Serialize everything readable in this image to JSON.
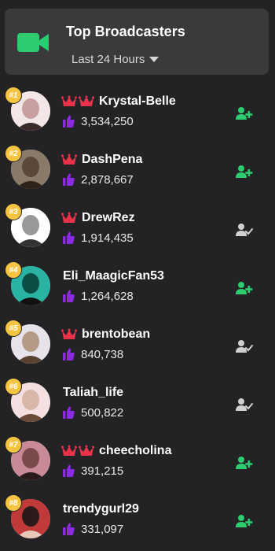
{
  "header": {
    "title": "Top Broadcasters",
    "period_label": "Last 24 Hours",
    "icon": "video-camera-icon",
    "accent_color": "#2ecc71"
  },
  "colors": {
    "rank_badge": "#f5c542",
    "crown": "#e8334a",
    "thumb": "#8a2be2",
    "follow_add": "#2ecc71",
    "following": "#d0d0d0"
  },
  "broadcasters": [
    {
      "rank": "#1",
      "name": "Krystal-Belle",
      "likes": "3,534,250",
      "crowns": 2,
      "follow_state": "add"
    },
    {
      "rank": "#2",
      "name": "DashPena",
      "likes": "2,878,667",
      "crowns": 1,
      "follow_state": "add"
    },
    {
      "rank": "#3",
      "name": "DrewRez",
      "likes": "1,914,435",
      "crowns": 1,
      "follow_state": "following"
    },
    {
      "rank": "#4",
      "name": "Eli_MaagicFan53",
      "likes": "1,264,628",
      "crowns": 0,
      "follow_state": "add"
    },
    {
      "rank": "#5",
      "name": "brentobean",
      "likes": "840,738",
      "crowns": 1,
      "follow_state": "following"
    },
    {
      "rank": "#6",
      "name": "Taliah_life",
      "likes": "500,822",
      "crowns": 0,
      "follow_state": "following"
    },
    {
      "rank": "#7",
      "name": "cheecholina",
      "likes": "391,215",
      "crowns": 2,
      "follow_state": "add"
    },
    {
      "rank": "#8",
      "name": "trendygurl29",
      "likes": "331,097",
      "crowns": 0,
      "follow_state": "add"
    }
  ]
}
